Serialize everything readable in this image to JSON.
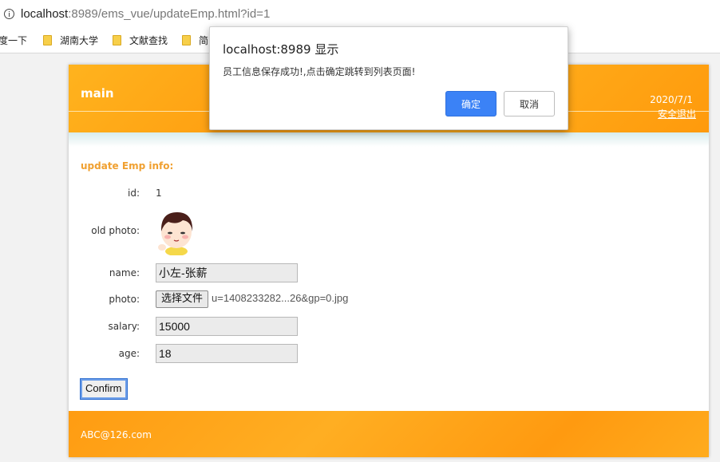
{
  "browser": {
    "url_host": "localhost",
    "url_rest": ":8989/ems_vue/updateEmp.html?id=1",
    "bookmarks": [
      "度一下",
      "湖南大学",
      "文献查找",
      "简"
    ]
  },
  "header": {
    "logo": "main",
    "date": "2020/7/1",
    "logout_label": "安全退出"
  },
  "form": {
    "title": "update Emp info:",
    "id_label": "id:",
    "id_value": "1",
    "old_photo_label": "old photo:",
    "name_label": "name:",
    "name_value": "小左-张薪",
    "photo_label": "photo:",
    "file_button": "选择文件",
    "file_name": "u=1408233282...26&gp=0.jpg",
    "salary_label": "salary:",
    "salary_value": "15000",
    "age_label": "age:",
    "age_value": "18",
    "confirm_label": "Confirm"
  },
  "footer": {
    "text": "ABC@126.com"
  },
  "dialog": {
    "title": "localhost:8989 显示",
    "message": "员工信息保存成功!,点击确定跳转到列表页面!",
    "ok_label": "确定",
    "cancel_label": "取消"
  }
}
